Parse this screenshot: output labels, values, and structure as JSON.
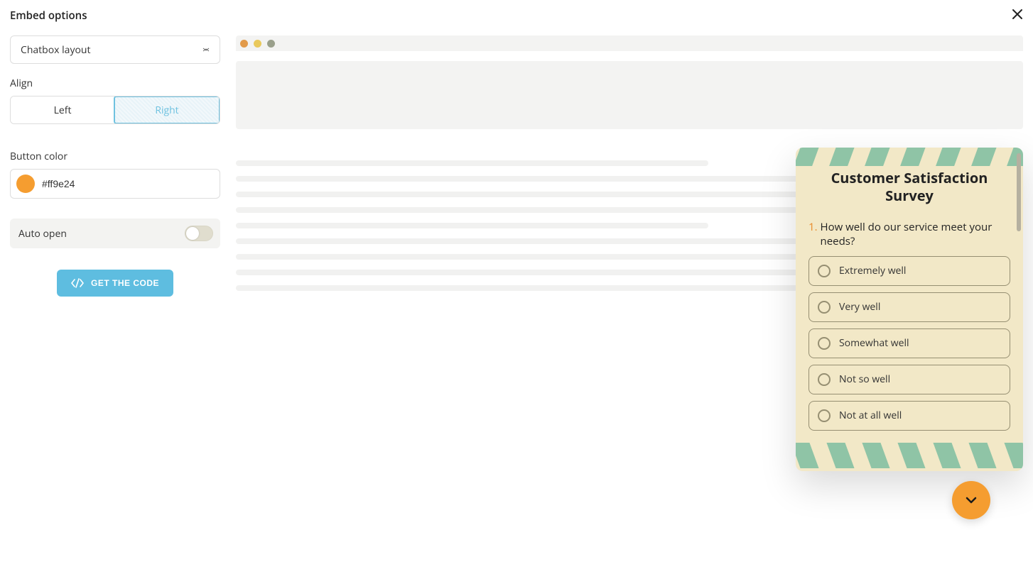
{
  "header": {
    "title": "Embed options"
  },
  "sidebar": {
    "layout_dropdown": {
      "value": "Chatbox layout"
    },
    "align": {
      "label": "Align",
      "left": "Left",
      "right": "Right",
      "selected": "Right"
    },
    "button_color": {
      "label": "Button color",
      "value": "#ff9e24"
    },
    "auto_open": {
      "label": "Auto open",
      "on": false
    },
    "get_code": "GET THE CODE"
  },
  "survey": {
    "title": "Customer Satisfaction Survey",
    "q_num": "1.",
    "q_text": "How well do our service meet your needs?",
    "options": [
      "Extremely well",
      "Very well",
      "Somewhat well",
      "Not so well",
      "Not at all well"
    ]
  },
  "colors": {
    "accent": "#f59d30",
    "teal": "#8fc4a6",
    "cream": "#f2e8c7"
  }
}
